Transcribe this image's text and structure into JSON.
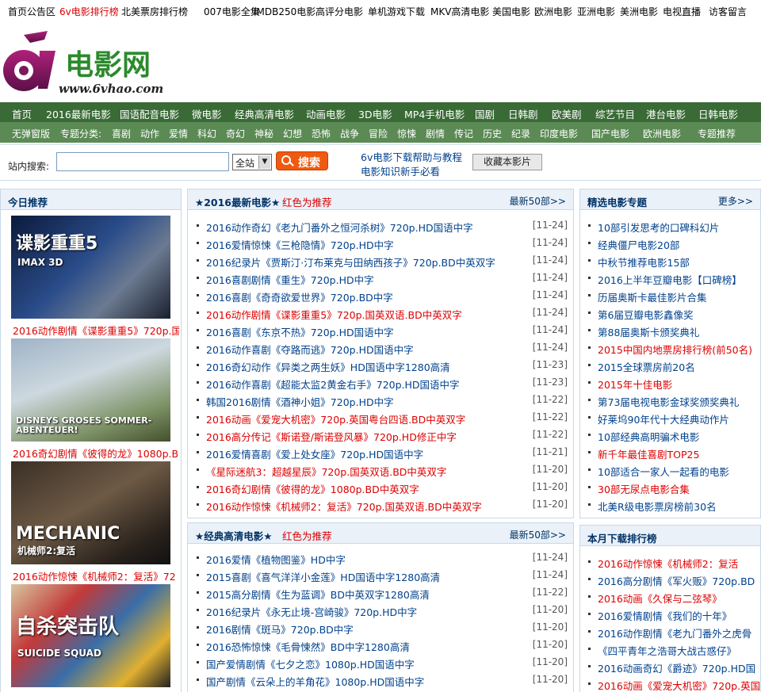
{
  "topbar": [
    {
      "label": "首页公告区",
      "red": false
    },
    {
      "label": "6v电影排行榜",
      "red": true
    },
    {
      "label": "北美票房排行榜",
      "red": false
    },
    {
      "label": "007电影全集",
      "red": false
    },
    {
      "label": "IMDB250电影",
      "red": false
    },
    {
      "label": "高评分电影",
      "red": false
    },
    {
      "label": "单机游戏下载",
      "red": false
    },
    {
      "label": "MKV高清电影",
      "red": false
    },
    {
      "label": "美国电影",
      "red": false
    },
    {
      "label": "欧洲电影",
      "red": false
    },
    {
      "label": "亚洲电影",
      "red": false
    },
    {
      "label": "美洲电影",
      "red": false
    },
    {
      "label": "电视直播",
      "red": false
    },
    {
      "label": "访客留言",
      "red": false
    }
  ],
  "logo": {
    "mark": "6v",
    "name": "电影网",
    "url": "www.6vhao.com"
  },
  "nav_main": [
    "首页",
    "2016最新电影",
    "国语配音电影",
    "微电影",
    "经典高清电影",
    "动画电影",
    "3D电影",
    "MP4手机电影",
    "国剧",
    "日韩剧",
    "欧美剧",
    "综艺节目",
    "港台电影",
    "日韩电影"
  ],
  "nav_sub": [
    "无弹窗版",
    "专题分类:",
    "喜剧",
    "动作",
    "爱情",
    "科幻",
    "奇幻",
    "神秘",
    "幻想",
    "恐怖",
    "战争",
    "冒险",
    "惊悚",
    "剧情",
    "传记",
    "历史",
    "纪录",
    "印度电影",
    "国产电影",
    "欧洲电影",
    "专题推荐"
  ],
  "search": {
    "label": "站内搜索:",
    "value": "",
    "scope": "全站",
    "button": "搜索",
    "help1": "6v电影下载帮助与教程",
    "help2": "电影知识新手必看",
    "bookmark": "收藏本影片"
  },
  "today": {
    "title": "今日推荐",
    "items": [
      {
        "caption": "2016动作剧情《谍影重重5》720p.国",
        "overlay": "谍影重重5",
        "sub": "IMAX 3D"
      },
      {
        "caption": "2016奇幻剧情《彼得的龙》1080p.B",
        "overlay": "DISNEYS GROSES SOMMER-ABENTEUER!",
        "sub": ""
      },
      {
        "caption": "2016动作惊悚《机械师2：复活》72",
        "overlay": "MECHANIC",
        "sub": "机械师2:复活"
      },
      {
        "caption": "",
        "overlay": "自杀突击队",
        "sub": "SUICIDE SQUAD"
      }
    ]
  },
  "latest": {
    "title": "★2016最新电影★",
    "hint": "红色为推荐",
    "more": "最新50部>>",
    "items": [
      {
        "t": "2016动作奇幻《老九门番外之恒河杀树》720p.HD国语中字",
        "d": "[11-24]",
        "r": false
      },
      {
        "t": "2016爱情惊悚《三枪隐情》720p.HD中字",
        "d": "[11-24]",
        "r": false
      },
      {
        "t": "2016纪录片《贾斯汀·汀布莱克与田纳西孩子》720p.BD中英双字",
        "d": "[11-24]",
        "r": false
      },
      {
        "t": "2016喜剧剧情《重生》720p.HD中字",
        "d": "[11-24]",
        "r": false
      },
      {
        "t": "2016喜剧《奇奇欲爱世界》720p.BD中字",
        "d": "[11-24]",
        "r": false
      },
      {
        "t": "2016动作剧情《谍影重重5》720p.国英双语.BD中英双字",
        "d": "[11-24]",
        "r": true
      },
      {
        "t": "2016喜剧《东京不热》720p.HD国语中字",
        "d": "[11-24]",
        "r": false
      },
      {
        "t": "2016动作喜剧《夺路而逃》720p.HD国语中字",
        "d": "[11-24]",
        "r": false
      },
      {
        "t": "2016奇幻动作《异类之两生妖》HD国语中字1280高清",
        "d": "[11-23]",
        "r": false
      },
      {
        "t": "2016动作喜剧《超能太监2黄金右手》720p.HD国语中字",
        "d": "[11-23]",
        "r": false
      },
      {
        "t": "韩国2016剧情《酒神小姐》720p.HD中字",
        "d": "[11-22]",
        "r": false
      },
      {
        "t": "2016动画《爱宠大机密》720p.英国粤台四语.BD中英双字",
        "d": "[11-22]",
        "r": true
      },
      {
        "t": "2016高分传记《斯诺登/斯诺登风暴》720p.HD修正中字",
        "d": "[11-22]",
        "r": true
      },
      {
        "t": "2016爱情喜剧《爱上处女座》720p.HD国语中字",
        "d": "[11-21]",
        "r": false
      },
      {
        "t": "《星际迷航3：超越星辰》720p.国英双语.BD中英双字",
        "d": "[11-20]",
        "r": true
      },
      {
        "t": "2016奇幻剧情《彼得的龙》1080p.BD中英双字",
        "d": "[11-20]",
        "r": true
      },
      {
        "t": "2016动作惊悚《机械师2：复活》720p.国英双语.BD中英双字",
        "d": "[11-20]",
        "r": true
      }
    ]
  },
  "classic": {
    "title": "★经典高清电影★",
    "hint": "红色为推荐",
    "more": "最新50部>>",
    "items": [
      {
        "t": "2016爱情《植物图鉴》HD中字",
        "d": "[11-24]",
        "r": false
      },
      {
        "t": "2015喜剧《喜气洋洋小金莲》HD国语中字1280高清",
        "d": "[11-24]",
        "r": false
      },
      {
        "t": "2015高分剧情《生为蓝调》BD中英双字1280高清",
        "d": "[11-22]",
        "r": false
      },
      {
        "t": "2016纪录片《永无止境-宫崎骏》720p.HD中字",
        "d": "[11-20]",
        "r": false
      },
      {
        "t": "2016剧情《斑马》720p.BD中字",
        "d": "[11-20]",
        "r": false
      },
      {
        "t": "2016恐怖惊悚《毛骨悚然》BD中字1280高清",
        "d": "[11-20]",
        "r": false
      },
      {
        "t": "国产爱情剧情《七夕之恋》1080p.HD国语中字",
        "d": "[11-20]",
        "r": false
      },
      {
        "t": "国产剧情《云朵上的羊角花》1080p.HD国语中字",
        "d": "[11-20]",
        "r": false
      }
    ]
  },
  "topics": {
    "title": "精选电影专题",
    "more": "更多>>",
    "items": [
      {
        "t": "10部引发思考的口碑科幻片",
        "r": false
      },
      {
        "t": "经典僵尸电影20部",
        "r": false
      },
      {
        "t": "中秋节推荐电影15部",
        "r": false
      },
      {
        "t": "2016上半年豆瓣电影【口碑榜】",
        "r": false
      },
      {
        "t": "历届奥斯卡最佳影片合集",
        "r": false
      },
      {
        "t": "第6届豆瓣电影鑫像奖",
        "r": false
      },
      {
        "t": "第88届奥斯卡颁奖典礼",
        "r": false
      },
      {
        "t": "2015中国内地票房排行榜(前50名)",
        "r": true
      },
      {
        "t": "2015全球票房前20名",
        "r": false
      },
      {
        "t": "2015年十佳电影",
        "r": true
      },
      {
        "t": "第73届电视电影金球奖颁奖典礼",
        "r": false
      },
      {
        "t": "好莱坞90年代十大经典动作片",
        "r": false
      },
      {
        "t": "10部经典高明骗术电影",
        "r": false
      },
      {
        "t": "新千年最佳喜剧TOP25",
        "r": true
      },
      {
        "t": "10部适合一家人一起看的电影",
        "r": false
      },
      {
        "t": "30部无尿点电影合集",
        "r": true
      },
      {
        "t": "北美R级电影票房榜前30名",
        "r": false
      }
    ]
  },
  "monthly": {
    "title": "本月下载排行榜",
    "items": [
      {
        "t": "2016动作惊悚《机械师2：复活",
        "r": true
      },
      {
        "t": "2016高分剧情《军火贩》720p.BD",
        "r": false
      },
      {
        "t": "2016动画《久保与二弦琴》",
        "r": true
      },
      {
        "t": "2016爱情剧情《我们的十年》",
        "r": false
      },
      {
        "t": "2016动作剧情《老九门番外之虎骨",
        "r": false
      },
      {
        "t": "《四平青年之浩哥大战古惑仔》",
        "r": false
      },
      {
        "t": "2016动画奇幻《爵迹》720p.HD国",
        "r": false
      },
      {
        "t": "2016动画《爱宠大机密》720p.英国",
        "r": true
      }
    ]
  }
}
